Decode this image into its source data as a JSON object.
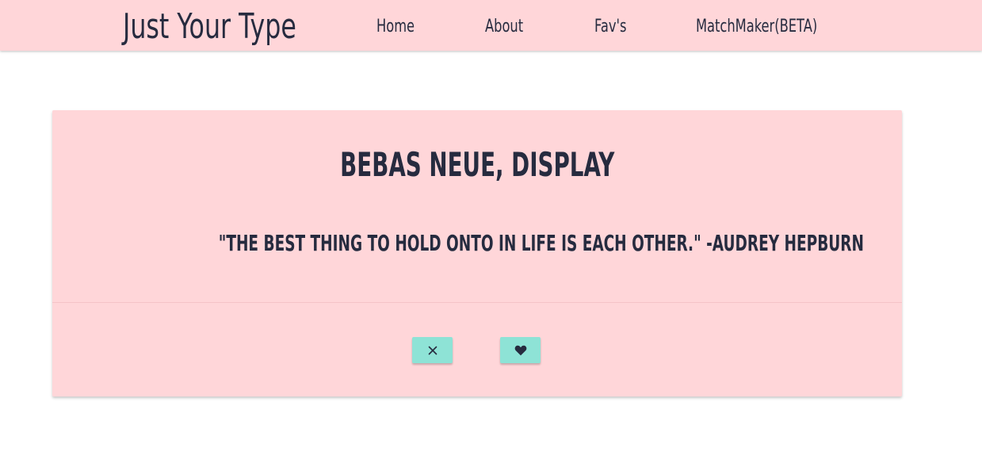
{
  "navbar": {
    "brand": "Just Your Type",
    "links": [
      "Home",
      "About",
      "Fav's",
      "MatchMaker(BETA)"
    ]
  },
  "card": {
    "font_name": "BEBAS NEUE, DISPLAY",
    "quote": "\"THE BEST THING TO HOLD ONTO IN LIFE IS EACH OTHER.\" -AUDREY HEPBURN",
    "buttons": {
      "dislike_icon": "close-icon",
      "like_icon": "heart-icon"
    }
  },
  "colors": {
    "background_pink": "#ffd6d9",
    "button_teal": "#8ee3d6",
    "text_dark": "#262b3f"
  }
}
